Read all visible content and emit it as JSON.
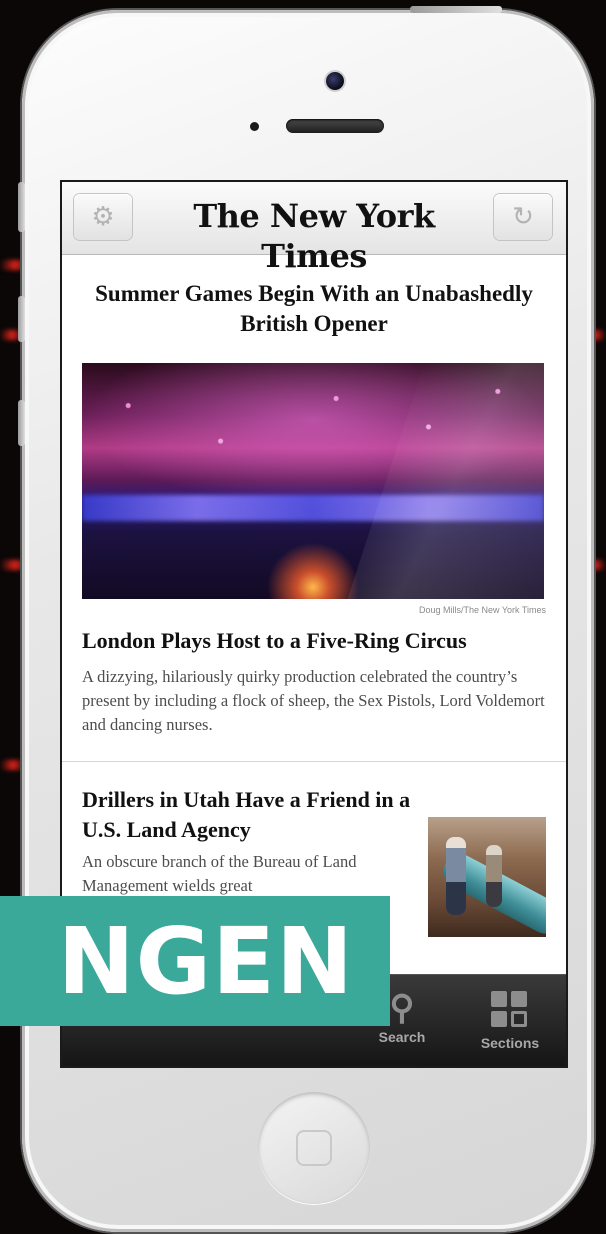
{
  "navbar": {
    "masthead": "The New York Times",
    "settings_icon": "gear-icon",
    "refresh_icon": "refresh-icon"
  },
  "lead_story": {
    "headline": "Summer Games Begin With an Unabashedly British Opener",
    "photo_credit": "Doug Mills/The New York Times",
    "title": "London Plays Host to a Five-Ring Circus",
    "summary": "A dizzying, hilariously quirky production celebrated the country’s present by including a flock of sheep, the Sex Pistols, Lord Voldemort and dancing nurses."
  },
  "second_story": {
    "title": "Drillers in Utah Have a Friend in a U.S. Land Agency",
    "summary": "An obscure branch of the Bureau of Land Management wields great"
  },
  "tabbar": {
    "tabs": [
      {
        "label": "Search",
        "icon": "search-icon"
      },
      {
        "label": "Sections",
        "icon": "sections-grid-icon"
      }
    ]
  },
  "overlay": {
    "banner_text": "NGEN"
  },
  "colors": {
    "banner": "#3aa99a",
    "tabbar": "#1e1e1e"
  }
}
